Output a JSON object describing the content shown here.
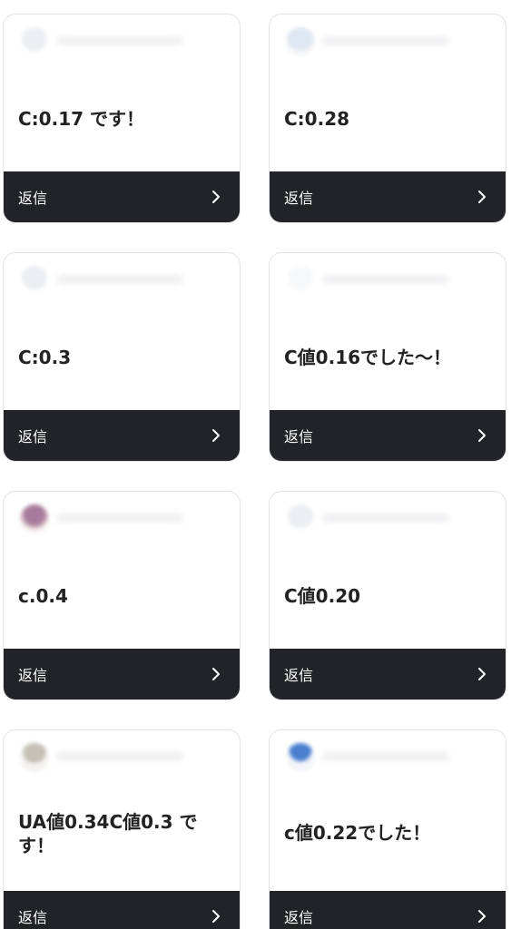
{
  "reply_label": "返信",
  "cards": [
    {
      "comment": "C:0.17 です！"
    },
    {
      "comment": "C:0.28"
    },
    {
      "comment": "C:0.3"
    },
    {
      "comment": "C値0.16でした〜！"
    },
    {
      "comment": "c.0.4"
    },
    {
      "comment": "C値0.20"
    },
    {
      "comment": "UA値0.34C値0.3 です！"
    },
    {
      "comment": "c値0.22でした！"
    }
  ],
  "icons": {
    "chevron": "chevron-right-icon",
    "avatar": "avatar"
  },
  "colors": {
    "footer_bg": "#222326",
    "footer_text": "#ffffff",
    "comment_text": "#222222",
    "card_border": "#e3e3e6"
  }
}
